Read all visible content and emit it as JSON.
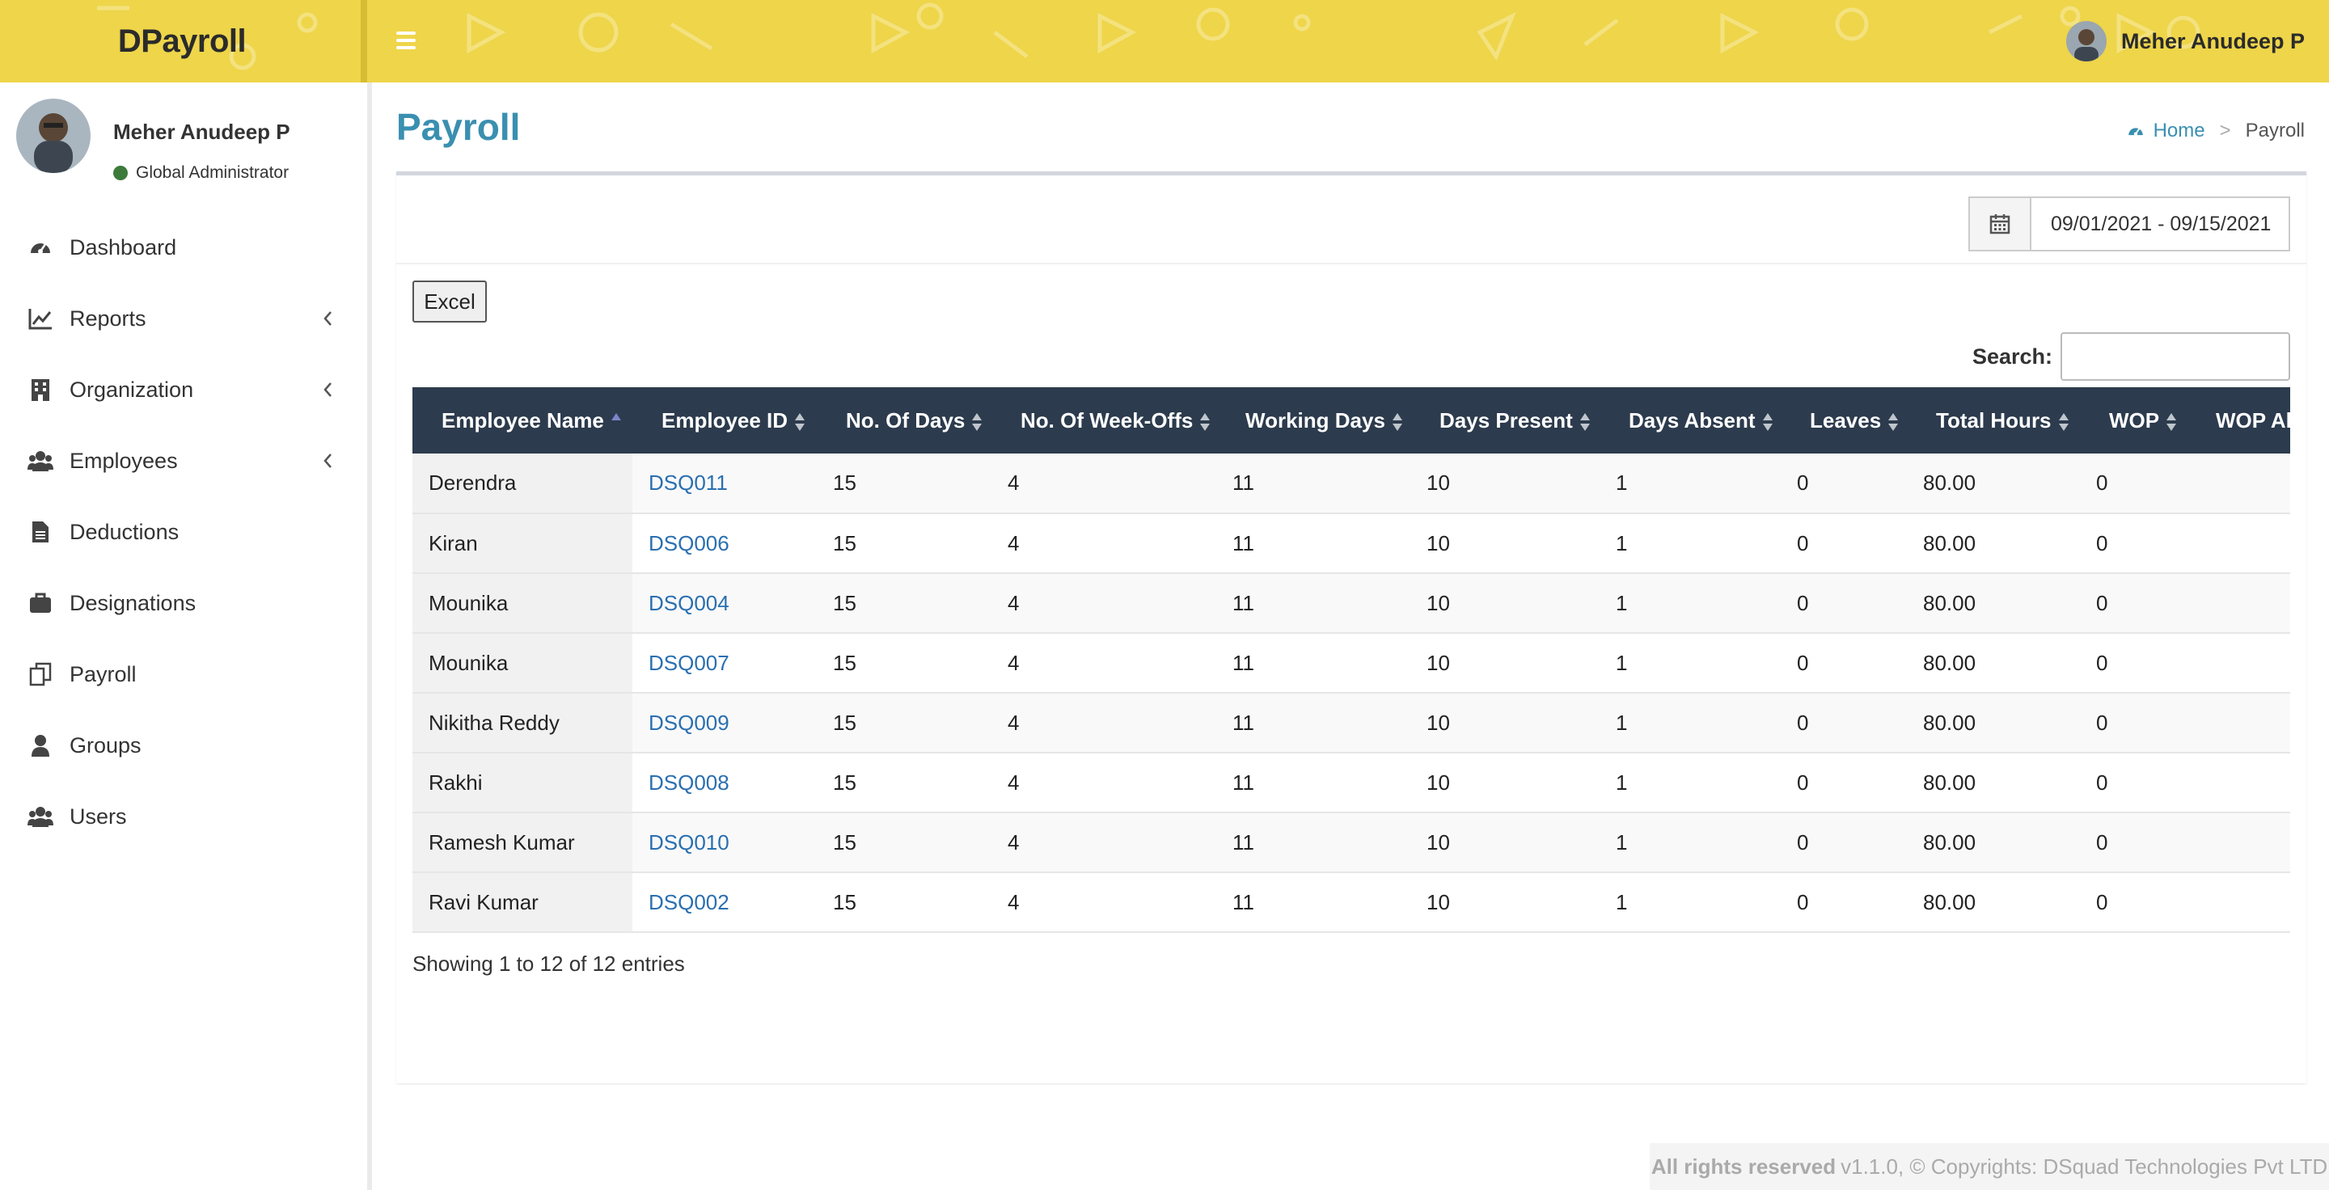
{
  "app": {
    "brand": "DPayroll",
    "user_name": "Meher Anudeep P"
  },
  "sidebar": {
    "user": {
      "name": "Meher Anudeep P",
      "role": "Global Administrator"
    },
    "items": [
      {
        "label": "Dashboard",
        "icon": "dashboard-icon",
        "has_children": false
      },
      {
        "label": "Reports",
        "icon": "chart-line-icon",
        "has_children": true
      },
      {
        "label": "Organization",
        "icon": "building-icon",
        "has_children": true
      },
      {
        "label": "Employees",
        "icon": "users-icon",
        "has_children": true
      },
      {
        "label": "Deductions",
        "icon": "file-icon",
        "has_children": false
      },
      {
        "label": "Designations",
        "icon": "briefcase-icon",
        "has_children": false
      },
      {
        "label": "Payroll",
        "icon": "copy-icon",
        "has_children": false
      },
      {
        "label": "Groups",
        "icon": "user-icon",
        "has_children": false
      },
      {
        "label": "Users",
        "icon": "users-icon",
        "has_children": false
      }
    ]
  },
  "page": {
    "title": "Payroll",
    "breadcrumb": {
      "home": "Home",
      "separator": ">",
      "current": "Payroll"
    }
  },
  "filters": {
    "date_range": "09/01/2021 - 09/15/2021"
  },
  "toolbar": {
    "excel_label": "Excel",
    "search_label": "Search:",
    "search_value": ""
  },
  "table": {
    "columns": [
      "Employee Name",
      "Employee ID",
      "No. Of Days",
      "No. Of Week-Offs",
      "Working Days",
      "Days Present",
      "Days Absent",
      "Leaves",
      "Total Hours",
      "WOP",
      "WOP Allowance"
    ],
    "sorted_column": "Employee Name",
    "rows": [
      [
        "Derendra",
        "DSQ011",
        "15",
        "4",
        "11",
        "10",
        "1",
        "0",
        "80.00",
        "0",
        ""
      ],
      [
        "Kiran",
        "DSQ006",
        "15",
        "4",
        "11",
        "10",
        "1",
        "0",
        "80.00",
        "0",
        ""
      ],
      [
        "Mounika",
        "DSQ004",
        "15",
        "4",
        "11",
        "10",
        "1",
        "0",
        "80.00",
        "0",
        ""
      ],
      [
        "Mounika",
        "DSQ007",
        "15",
        "4",
        "11",
        "10",
        "1",
        "0",
        "80.00",
        "0",
        ""
      ],
      [
        "Nikitha Reddy",
        "DSQ009",
        "15",
        "4",
        "11",
        "10",
        "1",
        "0",
        "80.00",
        "0",
        ""
      ],
      [
        "Rakhi",
        "DSQ008",
        "15",
        "4",
        "11",
        "10",
        "1",
        "0",
        "80.00",
        "0",
        ""
      ],
      [
        "Ramesh Kumar",
        "DSQ010",
        "15",
        "4",
        "11",
        "10",
        "1",
        "0",
        "80.00",
        "0",
        ""
      ],
      [
        "Ravi Kumar",
        "DSQ002",
        "15",
        "4",
        "11",
        "10",
        "1",
        "0",
        "80.00",
        "0",
        ""
      ]
    ],
    "info": "Showing 1 to 12 of 12 entries"
  },
  "footer": {
    "rights": "All rights reserved",
    "rest": "v1.1.0, © Copyrights: DSquad Technologies Pvt LTD"
  },
  "colors": {
    "topbar": "#eed54a",
    "header_row": "#2c3b4d",
    "accent": "#3a8fb0",
    "link": "#2a6fb0",
    "status_online": "#3c7a3c"
  }
}
